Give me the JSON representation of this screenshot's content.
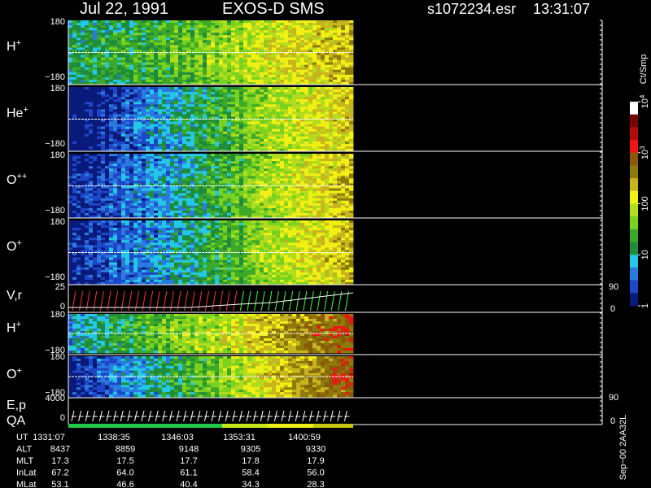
{
  "header": {
    "date": "Jul 22, 1991",
    "instrument": "EXOS-D SMS",
    "file": "s1072234.esr",
    "time": "13:31:07"
  },
  "colorbar": {
    "unit": "Ct/Smp",
    "ticks": [
      {
        "label": "1",
        "value": 1
      },
      {
        "label": "10",
        "value": 10
      },
      {
        "label": "100",
        "value": 100
      },
      {
        "label": "10^3",
        "value": 1000
      },
      {
        "label": "10^4",
        "value": 10000
      }
    ],
    "colors": [
      "#0a1a7a",
      "#1e46c8",
      "#2a7ae0",
      "#22c8e6",
      "#1e8c3c",
      "#3caa28",
      "#78d21e",
      "#b4dc1e",
      "#f0f014",
      "#c8b41e",
      "#8c7a0a",
      "#8a5a0a",
      "#f01414",
      "#b40a0a",
      "#780505",
      "#ffffff"
    ]
  },
  "panels": [
    {
      "id": "h-plus",
      "label": "H",
      "sup": "+",
      "top": "180",
      "bottom": "−180"
    },
    {
      "id": "he-plus",
      "label": "He",
      "sup": "+",
      "top": "180",
      "bottom": "−180"
    },
    {
      "id": "o-plusplus",
      "label": "O",
      "sup": "++",
      "top": "180",
      "bottom": "−180"
    },
    {
      "id": "o-plus",
      "label": "O",
      "sup": "+",
      "top": "180",
      "bottom": "−180"
    },
    {
      "id": "vr",
      "label": "V,r",
      "top": "25",
      "bottom": "0",
      "right_top": "90",
      "right_bottom": "0"
    },
    {
      "id": "h-plus-2",
      "label": "H",
      "sup": "+",
      "top": "180",
      "bottom": "−180"
    },
    {
      "id": "o-plus-2",
      "label": "O",
      "sup": "+",
      "top": "180",
      "bottom": "−180"
    },
    {
      "id": "ep",
      "label": "E,p",
      "top": "4000",
      "bottom": "0",
      "right_top": "90",
      "right_bottom": "0"
    },
    {
      "id": "qa",
      "label": "QA"
    }
  ],
  "ephemeris": {
    "row_labels": [
      "UT",
      "ALT",
      "MLT",
      "InLat",
      "MLat"
    ],
    "columns": [
      [
        "1331:07",
        "8437",
        "17.3",
        "67.2",
        "53.1"
      ],
      [
        "1338:35",
        "8859",
        "17.5",
        "64.0",
        "46.6"
      ],
      [
        "1346:03",
        "9148",
        "17.7",
        "61.1",
        "40.4"
      ],
      [
        "1353:31",
        "9305",
        "17.8",
        "58.4",
        "34.3"
      ],
      [
        "1400:59",
        "9330",
        "17.9",
        "56.0",
        "28.3"
      ]
    ]
  },
  "footer_tag": "Sep−00 2AA32L",
  "chart_data": {
    "type": "heatmap",
    "title": "Jul 22, 1991   EXOS-D SMS",
    "x_ticks": [
      "1331:07",
      "1338:35",
      "1346:03",
      "1353:31",
      "1400:59"
    ],
    "color_scale": {
      "label": "Ct/Smp",
      "log": true,
      "range": [
        1,
        10000
      ]
    },
    "series": [
      {
        "name": "H+",
        "ylim": [
          -180,
          180
        ],
        "trend": [
          20,
          40,
          150,
          400
        ]
      },
      {
        "name": "He+",
        "ylim": [
          -180,
          180
        ],
        "trend": [
          1,
          10,
          80,
          300
        ]
      },
      {
        "name": "O++",
        "ylim": [
          -180,
          180
        ],
        "trend": [
          2,
          10,
          80,
          400
        ]
      },
      {
        "name": "O+",
        "ylim": [
          -180,
          180
        ],
        "trend": [
          2,
          10,
          80,
          400
        ]
      },
      {
        "name": "H+",
        "ylim": [
          -180,
          180
        ],
        "trend": [
          10,
          60,
          300,
          1500
        ]
      },
      {
        "name": "O+",
        "ylim": [
          -180,
          180
        ],
        "trend": [
          2,
          20,
          200,
          1500
        ]
      }
    ],
    "line_panels": [
      {
        "name": "V,r",
        "ylim": [
          0,
          25
        ],
        "y2lim": [
          0,
          90
        ]
      },
      {
        "name": "E,p",
        "ylim": [
          0,
          4000
        ],
        "y2lim": [
          0,
          90
        ]
      }
    ]
  }
}
